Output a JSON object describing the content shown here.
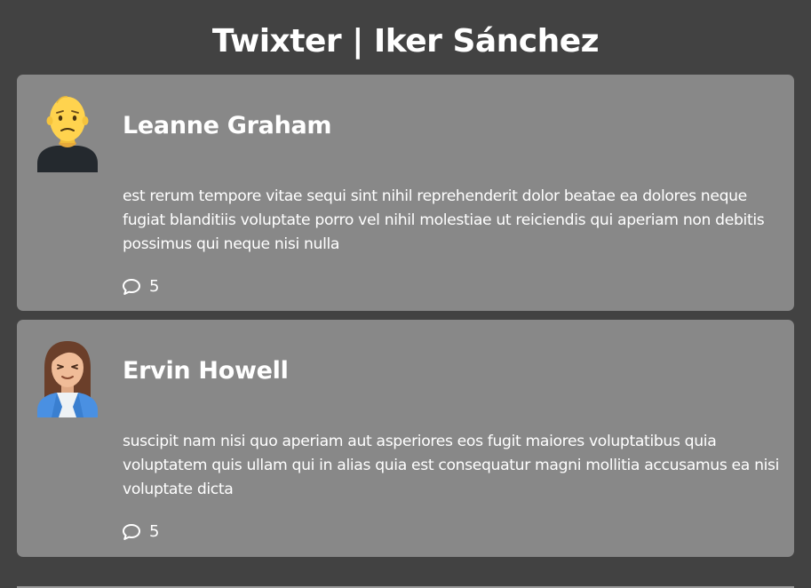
{
  "header": {
    "title": "Twixter | Iker Sánchez"
  },
  "posts": [
    {
      "author": "Leanne Graham",
      "body": "est rerum tempore vitae sequi sint nihil reprehenderit dolor beatae ea dolores neque fugiat blanditiis voluptate porro vel nihil molestiae ut reiciendis qui aperiam non debitis possimus qui neque nisi nulla",
      "comments": "5",
      "avatar_icon": "bald-man-avatar-icon"
    },
    {
      "author": "Ervin Howell",
      "body": "suscipit nam nisi quo aperiam aut asperiores eos fugit maiores voluptatibus quia voluptatem quis ullam qui in alias quia est consequatur magni mollitia accusamus ea nisi voluptate dicta",
      "comments": "5",
      "avatar_icon": "woman-avatar-icon"
    }
  ],
  "colors": {
    "background": "#424242",
    "card": "#888888",
    "text": "#ffffff"
  }
}
